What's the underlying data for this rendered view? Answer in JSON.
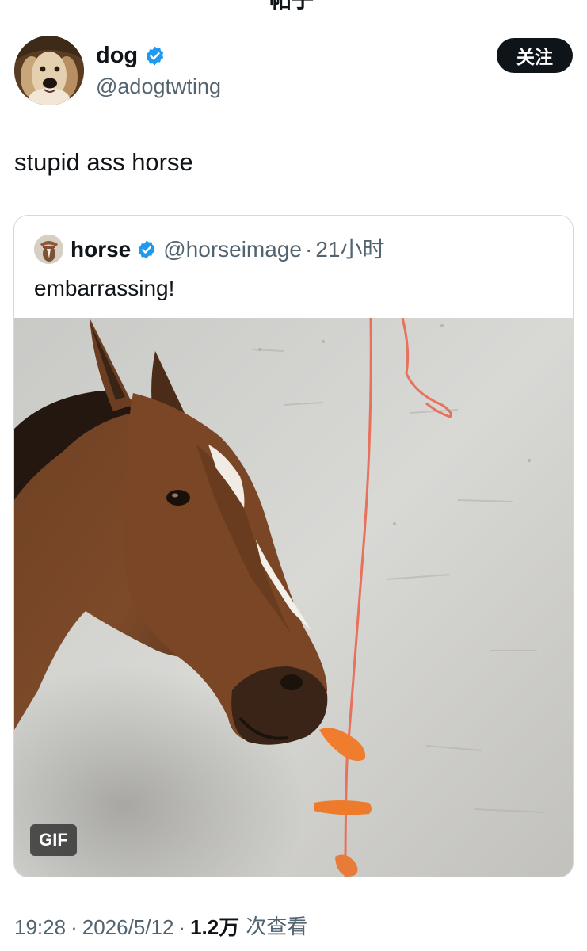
{
  "topbar": {
    "title": "帖子"
  },
  "author": {
    "name": "dog",
    "handle": "@adogtwting",
    "follow_label": "关注"
  },
  "tweet": {
    "text": "stupid ass horse"
  },
  "quote": {
    "name": "horse",
    "handle": "@horseimage",
    "separator": "·",
    "time": "21小时",
    "text": "embarrassing!",
    "media_badge": "GIF"
  },
  "meta": {
    "time": "19:28",
    "date": "2026/5/12",
    "separator": "·",
    "views_count": "1.2万",
    "views_label": "次查看"
  },
  "colors": {
    "verified": "#1d9bf0",
    "text_primary": "#0f1419",
    "text_secondary": "#536471",
    "border": "#cfd9de"
  },
  "icons": {
    "back": "arrow-left-icon",
    "verified": "verified-badge-icon"
  }
}
